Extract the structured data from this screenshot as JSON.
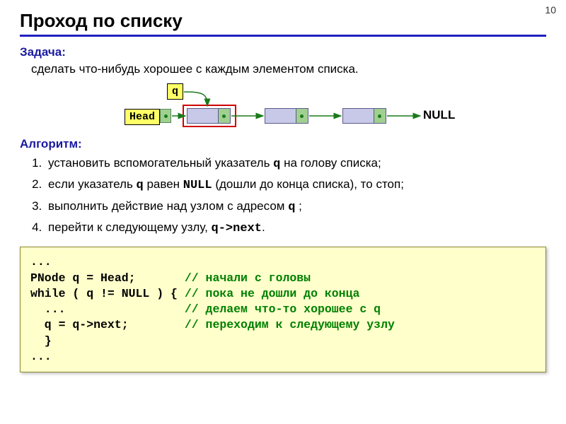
{
  "page_number": "10",
  "title": "Проход по списку",
  "task": {
    "label": "Задача:",
    "text": "сделать что-нибудь хорошее с каждым элементом списка."
  },
  "diagram": {
    "q_label": "q",
    "head_label": "Head",
    "null_label": "NULL"
  },
  "algorithm": {
    "label": "Алгоритм:",
    "steps": [
      {
        "pre": "установить вспомогательный указатель ",
        "m1": "q",
        "post": " на голову списка;"
      },
      {
        "pre": "если указатель ",
        "m1": "q",
        "mid": "  равен ",
        "m2": "NULL",
        "post": " (дошли до конца списка), то стоп;"
      },
      {
        "pre": "выполнить действие над узлом с адресом ",
        "m1": "q",
        "post": " ;"
      },
      {
        "pre": "перейти к следующему узлу, ",
        "m1": "q->next",
        "post": "."
      }
    ]
  },
  "code": {
    "l1": "...",
    "l2a": "PNode q = Head;       ",
    "l2c": "// начали с головы",
    "l3a": "while ( q != NULL ) { ",
    "l3c": "// пока не дошли до конца",
    "l4a": "  ...                 ",
    "l4c": "// делаем что-то хорошее с q",
    "l5a": "  q = q->next;        ",
    "l5c": "// переходим к следующему узлу",
    "l6": "  }",
    "l7": "..."
  }
}
